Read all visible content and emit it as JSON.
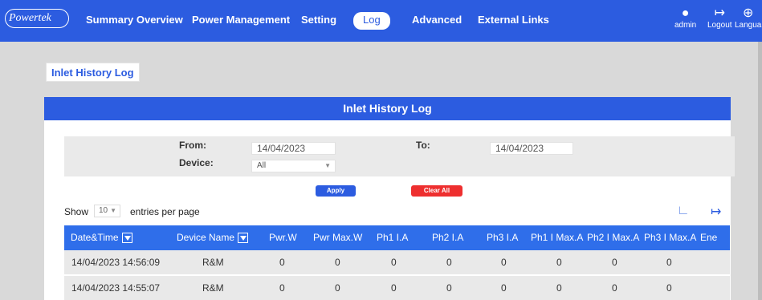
{
  "nav": {
    "logo": "Powertek",
    "items": [
      "Summary Overview",
      "Power Management",
      "Setting",
      "Log",
      "Advanced",
      "External Links"
    ],
    "active": "Log",
    "user_label": "admin",
    "logout_label": "Logout",
    "language_label": "Langua"
  },
  "page": {
    "tab_title": "Inlet History Log",
    "header": "Inlet History Log"
  },
  "filter": {
    "from_label": "From:",
    "from_value": "14/04/2023",
    "to_label": "To:",
    "to_value": "14/04/2023",
    "device_label": "Device:",
    "device_value": "All",
    "apply_label": "Apply",
    "clear_label": "Clear All"
  },
  "entries": {
    "show_label": "Show",
    "value": "10",
    "suffix": "entries per page"
  },
  "table": {
    "columns": [
      "Date&Time",
      "Device Name",
      "Pwr.W",
      "Pwr Max.W",
      "Ph1 I.A",
      "Ph2 I.A",
      "Ph3 I.A",
      "Ph1 I Max.A",
      "Ph2 I Max.A",
      "Ph3 I Max.A",
      "Ene"
    ],
    "rows": [
      [
        "14/04/2023 14:56:09",
        "R&M",
        "0",
        "0",
        "0",
        "0",
        "0",
        "0",
        "0",
        "0"
      ],
      [
        "14/04/2023 14:55:07",
        "R&M",
        "0",
        "0",
        "0",
        "0",
        "0",
        "0",
        "0",
        "0"
      ]
    ]
  },
  "colors": {
    "accent": "#2c5ce0",
    "table_header": "#2f6eea",
    "clear_button": "#ee2f2f"
  }
}
